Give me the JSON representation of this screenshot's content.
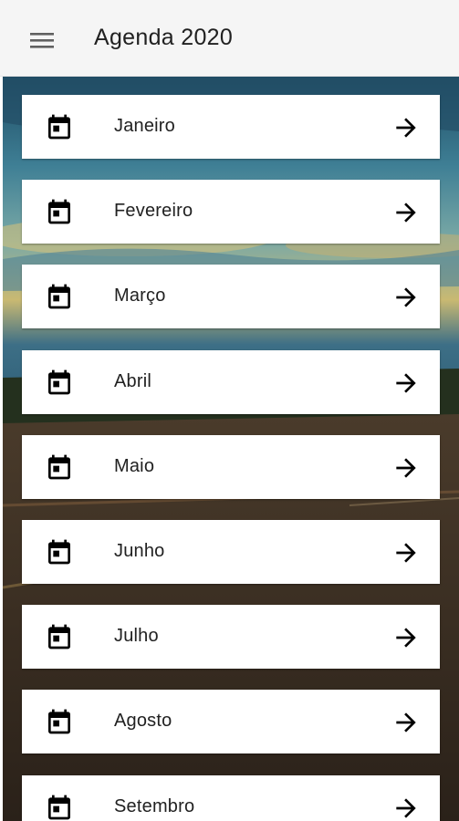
{
  "toolbar": {
    "title": "Agenda 2020",
    "menu_icon": "menu-icon"
  },
  "months": [
    {
      "label": "Janeiro"
    },
    {
      "label": "Fevereiro"
    },
    {
      "label": "Março"
    },
    {
      "label": "Abril"
    },
    {
      "label": "Maio"
    },
    {
      "label": "Junho"
    },
    {
      "label": "Julho"
    },
    {
      "label": "Agosto"
    },
    {
      "label": "Setembro"
    }
  ],
  "icons": {
    "item_leading": "calendar-today-icon",
    "item_trailing": "arrow-forward-icon"
  },
  "colors": {
    "toolbar_bg": "#f5f5f5",
    "card_bg": "#ffffff",
    "text": "#212121",
    "icon": "#000000"
  }
}
